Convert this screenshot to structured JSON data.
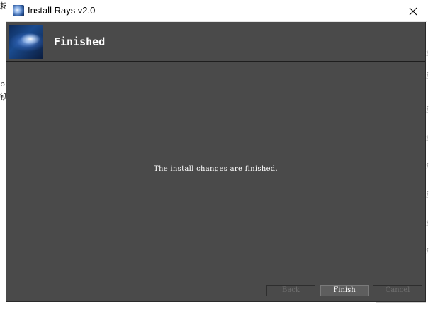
{
  "window": {
    "title": "Install Rays v2.0",
    "icon": "app-icon"
  },
  "header": {
    "title": "Finished",
    "image": "rays-banner-image"
  },
  "content": {
    "message": "The install changes are finished."
  },
  "buttons": {
    "back": "Back",
    "finish": "Finish",
    "cancel": "Cancel"
  },
  "colors": {
    "window_bg": "#4a4a4a",
    "titlebar_bg": "#ffffff",
    "text": "#ffffff",
    "disabled_text": "#6e6e6e"
  }
}
